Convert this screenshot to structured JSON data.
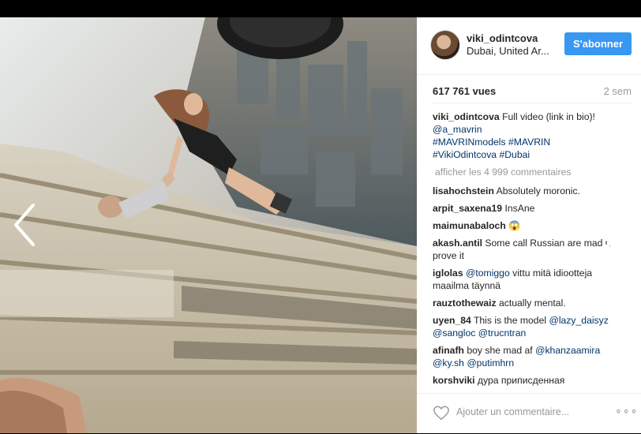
{
  "post": {
    "username": "viki_odintcova",
    "location": "Dubai, United Ar...",
    "follow_label": "S'abonner",
    "views": "617 761 vues",
    "age": "2 sem",
    "caption": {
      "user": "viki_odintcova",
      "text": "Full video (link in bio)!",
      "tags": [
        "@a_mavrin",
        "#MAVRINmodels",
        "#MAVRIN",
        "#VikiOdintcova",
        "#Dubai"
      ]
    },
    "more_comments_label": "afficher les 4 999 commentaires",
    "add_comment_placeholder": "Ajouter un commentaire...",
    "more_label": "∘∘∘"
  },
  "comments": [
    {
      "user": "lisahochstein",
      "text": "Absolutely moronic."
    },
    {
      "user": "arpit_saxena19",
      "text": "InsAne"
    },
    {
      "user": "maimunabaloch",
      "text": "😱"
    },
    {
      "user": "akash.antil",
      "text": "Some call Russian are mad u prove it"
    },
    {
      "user": "iglolas",
      "mention": "@tomiggo",
      "text": "vittu mitä idiootteja maailma täynnä"
    },
    {
      "user": "rauztothewaiz",
      "text": "actually mental."
    },
    {
      "user": "uyen_84",
      "text": "This is the model",
      "mention": "@lazy_daisyz",
      "mention2": "@sangloc",
      "mention3": "@trucntran"
    },
    {
      "user": "afinafh",
      "text": "boy she mad af",
      "mention": "@khanzaamira",
      "mention2": "@ky.sh",
      "mention3": "@putimhrn"
    },
    {
      "user": "korshviki",
      "text": "дура приписденная"
    }
  ],
  "icons": {
    "prev": "chevron-left-icon",
    "next": "chevron-right-icon",
    "like": "heart-icon",
    "more": "more-options-icon"
  },
  "colors": {
    "follow_button": "#3897f0",
    "tag": "#003569",
    "muted": "#999999"
  }
}
